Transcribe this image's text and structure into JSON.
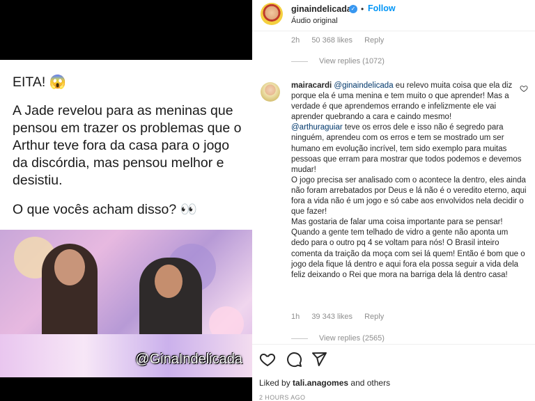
{
  "post": {
    "line1": "EITA! 😱",
    "paragraph1": "A Jade revelou para as meninas que pensou em trazer os problemas que o Arthur teve fora da casa para o jogo da discórdia, mas pensou melhor e desistiu.",
    "paragraph2": "O que vocês acham disso? 👀",
    "watermark": "@GinaIndelicada"
  },
  "header": {
    "username": "ginaindelicada",
    "follow_label": "Follow",
    "dot": "•",
    "audio": "Áudio original"
  },
  "prev_comment": {
    "time": "2h",
    "likes": "50 368 likes",
    "reply_label": "Reply",
    "view_replies": "View replies (1072)"
  },
  "comment": {
    "username": "mairacardi",
    "mention1": "@ginaindelicada",
    "text1": " eu relevo muita coisa que ela diz porque ela é uma menina e tem muito o que aprender! Mas a verdade é que aprendemos errando e infelizmente ele vai aprender quebrando a cara e caindo mesmo!",
    "mention2": "@arthuraguiar",
    "text2": " teve os erros dele e isso não é segredo para ninguém, aprendeu com os erros e tem se mostrado um ser humano em evolução incrível, tem sido exemplo para muitas pessoas que erram para mostrar que todos podemos e devemos mudar!",
    "text3": "O jogo precisa ser analisado com o acontece la dentro, eles ainda não foram arrebatados por Deus e lá não é o veredito eterno, aqui fora a vida não é um jogo e só cabe aos envolvidos nela decidir o que fazer!",
    "text4": "Mas gostaria de falar uma coisa importante para se pensar! Quando a gente tem telhado de vidro a gente não aponta um dedo para o outro pq 4 se voltam para nós! O Brasil inteiro comenta da traição da moça com sei lá quem! Então é bom que o jogo dela fique lá dentro e aqui fora ela possa seguir a vida dela feliz deixando o Rei que mora na barriga dela lá dentro casa!",
    "time": "1h",
    "likes": "39 343 likes",
    "reply_label": "Reply",
    "view_replies": "View replies (2565)"
  },
  "footer": {
    "liked_prefix": "Liked by ",
    "liked_user": "tali.anagomes",
    "liked_suffix": " and others",
    "timestamp": "2 HOURS AGO"
  },
  "icons": [
    "verified-icon",
    "heart-icon",
    "comment-icon",
    "share-icon"
  ],
  "colors": {
    "accent": "#0095f6",
    "verified": "#3897f0",
    "mention": "#00376b",
    "muted": "#8e8e8e"
  }
}
